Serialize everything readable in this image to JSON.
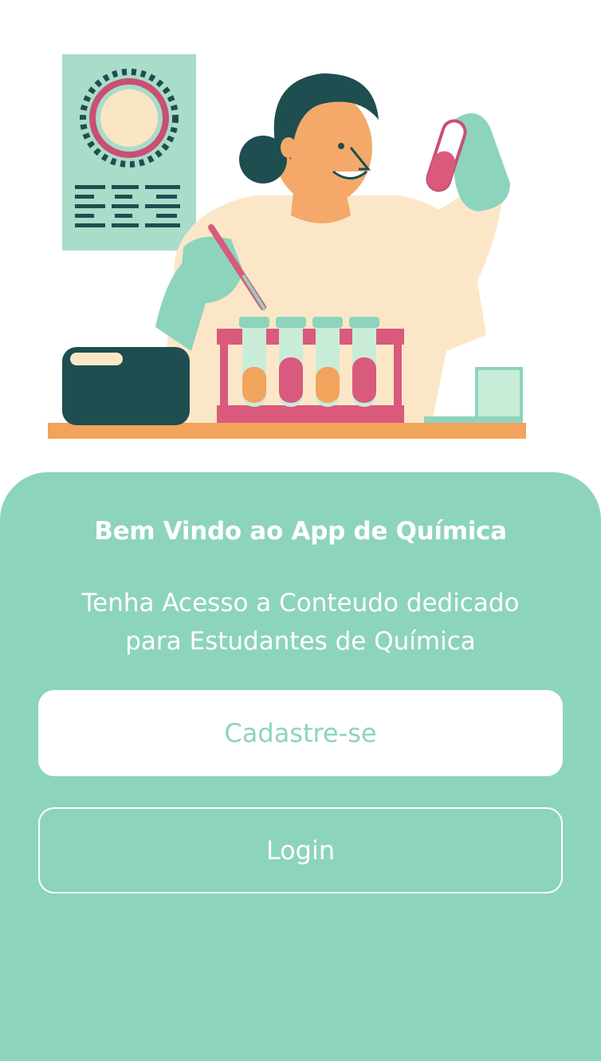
{
  "welcome": {
    "title": "Bem Vindo ao App de Química",
    "subtitle_line1": "Tenha Acesso a Conteudo dedicado",
    "subtitle_line2": "para Estudantes de Química"
  },
  "buttons": {
    "register_label": "Cadastre-se",
    "login_label": "Login"
  },
  "colors": {
    "accent": "#8dd4bd",
    "background": "#ffffff",
    "tube_pink": "#d95a7c",
    "tube_orange": "#f2a35c",
    "dark_teal": "#1e4e4f"
  },
  "illustration": {
    "name": "scientist-with-test-tubes-illustration"
  }
}
